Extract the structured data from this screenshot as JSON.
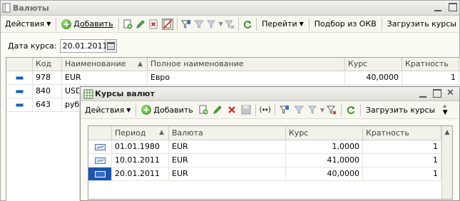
{
  "outer_window": {
    "title": "Валюты",
    "toolbar": {
      "actions": "Действия",
      "add": "Добавить",
      "goto": "Перейти",
      "pick_okv": "Подбор из ОКВ",
      "load_rates": "Загрузить курсы"
    },
    "date_label": "Дата курса:",
    "date_value": "20.01.2011",
    "columns": [
      "Код",
      "Наименование",
      "Полное наименование",
      "Курс",
      "Кратность"
    ],
    "rows": [
      {
        "code": "978",
        "name": "EUR",
        "full_name": "Евро",
        "rate": "40,0000",
        "mult": "1"
      },
      {
        "code": "840",
        "name": "USD",
        "full_name": "",
        "rate": "",
        "mult": ""
      },
      {
        "code": "643",
        "name": "руб.",
        "full_name": "",
        "rate": "",
        "mult": ""
      }
    ]
  },
  "inner_window": {
    "title": "Курсы валют",
    "toolbar": {
      "actions": "Действия",
      "add": "Добавить",
      "load_rates": "Загрузить курсы"
    },
    "columns": [
      "Период",
      "Валюта",
      "Курс",
      "Кратность"
    ],
    "rows": [
      {
        "period": "01.01.1980",
        "currency": "EUR",
        "rate": "1,0000",
        "mult": "1"
      },
      {
        "period": "10.01.2011",
        "currency": "EUR",
        "rate": "41,0000",
        "mult": "1"
      },
      {
        "period": "20.01.2011",
        "currency": "EUR",
        "rate": "40,0000",
        "mult": "1"
      }
    ]
  },
  "colors": {
    "add_green": "#2f8f1d",
    "edit_green": "#3a9a2a",
    "delete_red": "#d32020",
    "row_icon_blue": "#1b5fb2",
    "selection_blue": "#1c55b0"
  }
}
